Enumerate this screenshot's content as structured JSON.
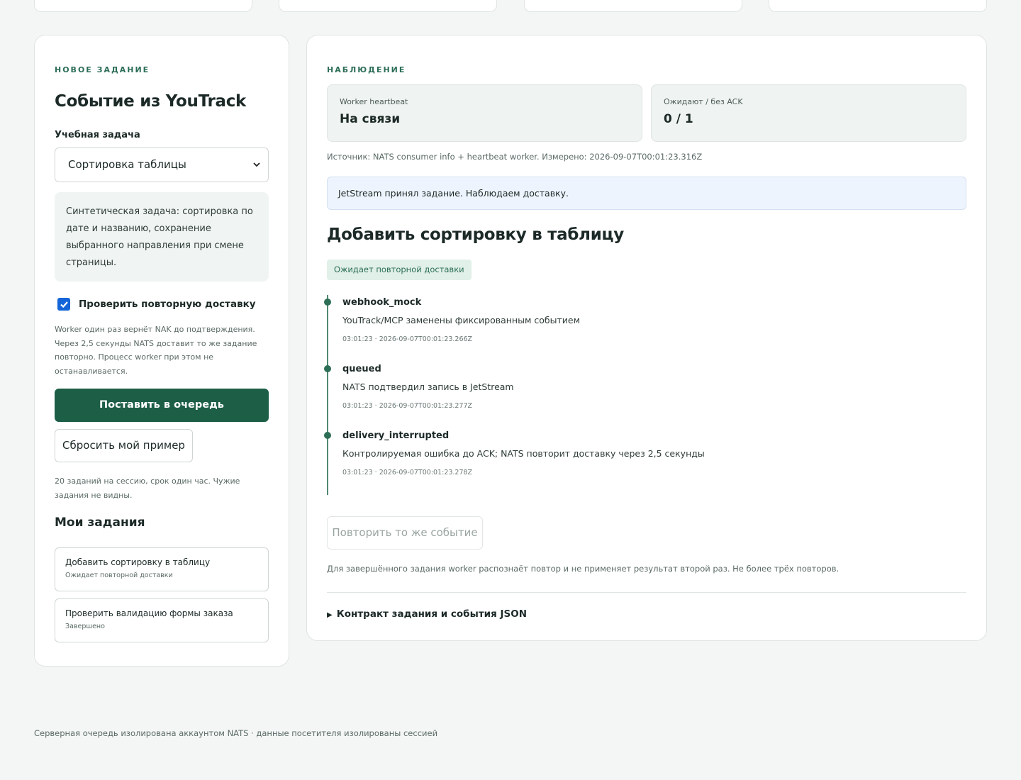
{
  "left": {
    "eyebrow": "НОВОЕ ЗАДАНИЕ",
    "title": "Событие из YouTrack",
    "task_label": "Учебная задача",
    "task_select_value": "Сортировка таблицы",
    "task_description": "Синтетическая задача: сортировка по дате и названию, сохранение выбранного направления при смене страницы.",
    "redelivery_checkbox_label": "Проверить повторную доставку",
    "redelivery_checked": true,
    "redelivery_hint": "Worker один раз вернёт NAK до подтверждения. Через 2,5 секунды NATS доставит то же задание повторно. Процесс worker при этом не останавливается.",
    "enqueue_button": "Поставить в очередь",
    "reset_button": "Сбросить мой пример",
    "limits_hint": "20 заданий на сессию, срок один час. Чужие задания не видны.",
    "my_tasks_title": "Мои задания",
    "my_tasks": [
      {
        "title": "Добавить сортировку в таблицу",
        "status": "Ожидает повторной доставки"
      },
      {
        "title": "Проверить валидацию формы заказа",
        "status": "Завершено"
      }
    ]
  },
  "right": {
    "eyebrow": "НАБЛЮДЕНИЕ",
    "stats": [
      {
        "label": "Worker heartbeat",
        "value": "На связи"
      },
      {
        "label": "Ожидают / без ACK",
        "value": "0 / 1"
      }
    ],
    "source": "Источник: NATS consumer info + heartbeat worker. Измерено: 2026-09-07T00:01:23.316Z",
    "info_message": "JetStream принял задание. Наблюдаем доставку.",
    "task_title": "Добавить сортировку в таблицу",
    "status_badge": "Ожидает повторной доставки",
    "events": [
      {
        "name": "webhook_mock",
        "message": "YouTrack/MCP заменены фиксированным событием",
        "time": "03:01:23 · 2026-09-07T00:01:23.266Z"
      },
      {
        "name": "queued",
        "message": "NATS подтвердил запись в JetStream",
        "time": "03:01:23 · 2026-09-07T00:01:23.277Z"
      },
      {
        "name": "delivery_interrupted",
        "message": "Контролируемая ошибка до ACK; NATS повторит доставку через 2,5 секунды",
        "time": "03:01:23 · 2026-09-07T00:01:23.278Z"
      }
    ],
    "repeat_button": "Повторить то же событие",
    "repeat_note": "Для завершённого задания worker распознаёт повтор и не применяет результат второй раз. Не более трёх повторов.",
    "details_summary": "Контракт задания и события JSON"
  },
  "footer": "Серверная очередь изолирована аккаунтом NATS · данные посетителя изолированы сессией",
  "colors": {
    "accent": "#1d5e47",
    "eyebrow": "#2c6e56",
    "checkbox": "#1565d8",
    "info_bg": "#eef4fd",
    "badge_bg": "#e1f0e8"
  },
  "icons": {
    "select": "chevron-down-icon",
    "checkbox": "checkmark-icon",
    "details": "triangle-right-icon"
  }
}
